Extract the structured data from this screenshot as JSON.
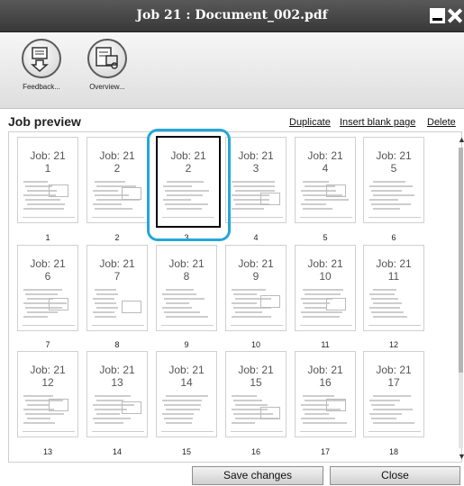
{
  "window": {
    "title": "Job 21 : Document_002.pdf"
  },
  "toolbar": {
    "tools": [
      {
        "label": "Feedback...",
        "icon": "feedback-icon"
      },
      {
        "label": "Overview...",
        "icon": "overview-icon"
      }
    ]
  },
  "preview": {
    "title": "Job preview",
    "actions": {
      "duplicate": "Duplicate",
      "insert_blank": "Insert blank page",
      "delete": "Delete"
    },
    "selected_page": 3,
    "pages": [
      {
        "job": "Job: 21",
        "number": "1",
        "label": "1"
      },
      {
        "job": "Job: 21",
        "number": "2",
        "label": "2"
      },
      {
        "job": "Job: 21",
        "number": "2",
        "label": "3"
      },
      {
        "job": "Job: 21",
        "number": "3",
        "label": "4"
      },
      {
        "job": "Job: 21",
        "number": "4",
        "label": "5"
      },
      {
        "job": "Job: 21",
        "number": "5",
        "label": "6"
      },
      {
        "job": "Job: 21",
        "number": "6",
        "label": "7"
      },
      {
        "job": "Job: 21",
        "number": "7",
        "label": "8"
      },
      {
        "job": "Job: 21",
        "number": "8",
        "label": "9"
      },
      {
        "job": "Job: 21",
        "number": "9",
        "label": "10"
      },
      {
        "job": "Job: 21",
        "number": "10",
        "label": "11"
      },
      {
        "job": "Job: 21",
        "number": "11",
        "label": "12"
      },
      {
        "job": "Job: 21",
        "number": "12",
        "label": "13"
      },
      {
        "job": "Job: 21",
        "number": "13",
        "label": "14"
      },
      {
        "job": "Job: 21",
        "number": "14",
        "label": "15"
      },
      {
        "job": "Job: 21",
        "number": "15",
        "label": "16"
      },
      {
        "job": "Job: 21",
        "number": "16",
        "label": "17"
      },
      {
        "job": "Job: 21",
        "number": "17",
        "label": "18"
      }
    ]
  },
  "footer": {
    "save_label": "Save changes",
    "close_label": "Close"
  },
  "colors": {
    "selection_ring": "#23a7d8",
    "titlebar": "#444444"
  }
}
